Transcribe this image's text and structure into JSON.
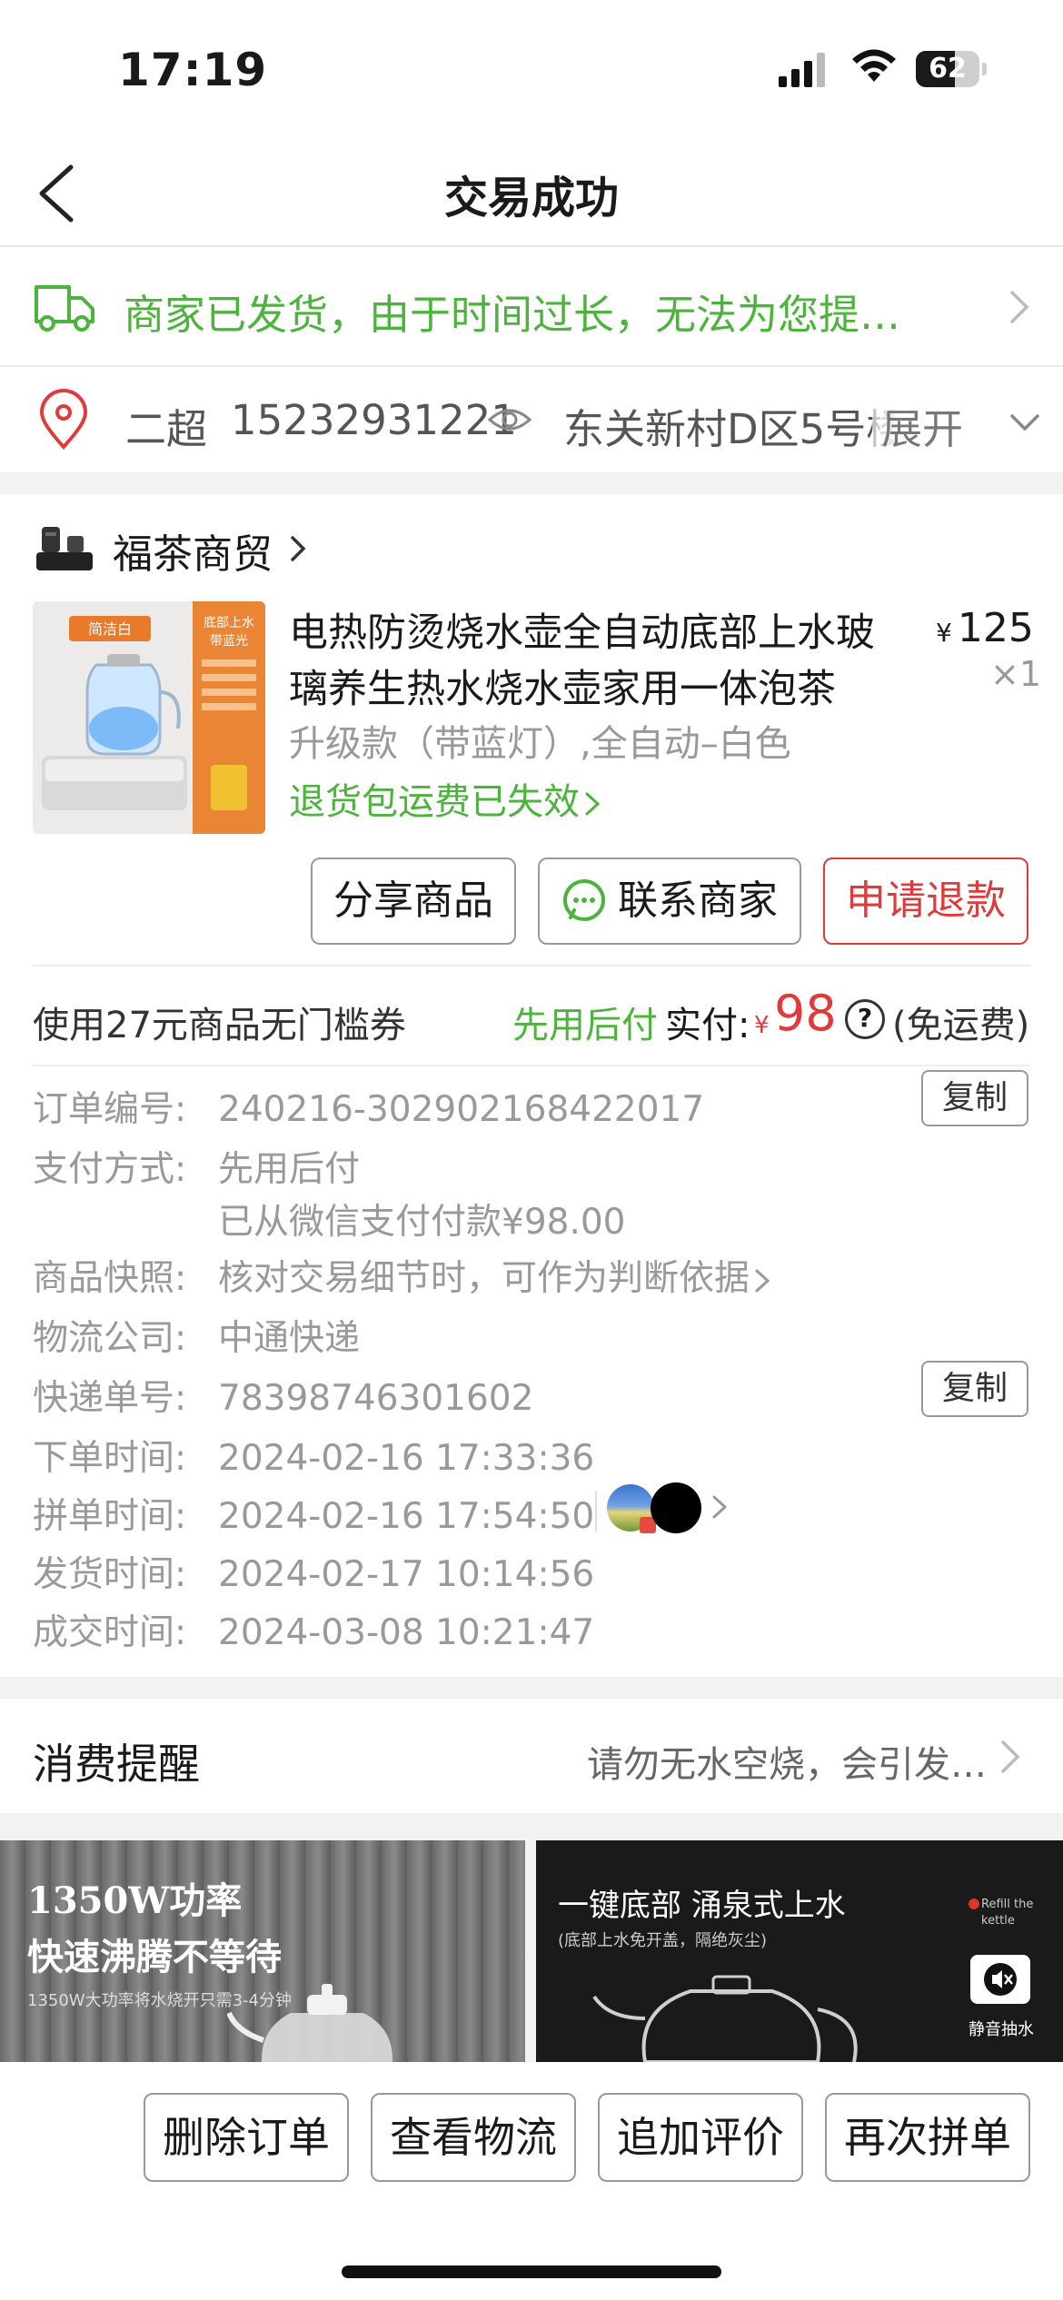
{
  "status_bar": {
    "time": "17:19",
    "battery": "62"
  },
  "nav": {
    "title": "交易成功"
  },
  "shipping": {
    "text": "商家已发货，由于时间过长，无法为您提…"
  },
  "address": {
    "name": "二超",
    "phone": "15232931221",
    "detail": "东关新村D区5号楼",
    "expand": "展开"
  },
  "shop": {
    "name": "福茶商贸"
  },
  "product": {
    "title": "电热防烫烧水壶全自动底部上水玻璃养生热水烧水壶家用一体泡茶",
    "currency": "¥",
    "price": "125",
    "qty": "×1",
    "spec": "升级款（带蓝灯）,全自动–白色",
    "return_note": "退货包运费已失效",
    "image_tag": "简洁白",
    "image_side": "底部上水带蓝光"
  },
  "actions": {
    "share": "分享商品",
    "contact": "联系商家",
    "refund": "申请退款"
  },
  "payment": {
    "coupon": "使用27元商品无门槛券",
    "pay_later": "先用后付",
    "paid_label": "实付:",
    "currency": "¥",
    "amount": "98",
    "help": "?",
    "free_shipping": "(免运费)"
  },
  "details": {
    "order_no_label": "订单编号:",
    "order_no": "240216-302902168422017",
    "copy": "复制",
    "pay_method_label": "支付方式:",
    "pay_method": "先用后付",
    "pay_method_note": "已从微信支付付款¥98.00",
    "snapshot_label": "商品快照:",
    "snapshot": "核对交易细节时，可作为判断依据",
    "courier_label": "物流公司:",
    "courier": "中通快递",
    "tracking_label": "快递单号:",
    "tracking": "78398746301602",
    "order_time_label": "下单时间:",
    "order_time": "2024-02-16 17:33:36",
    "group_time_label": "拼单时间:",
    "group_time": "2024-02-16 17:54:50",
    "ship_time_label": "发货时间:",
    "ship_time": "2024-02-17 10:14:56",
    "deal_time_label": "成交时间:",
    "deal_time": "2024-03-08 10:21:47"
  },
  "tips": {
    "title": "消费提醒",
    "text": "请勿无水空烧，会引发…"
  },
  "banners": {
    "left_line1": "1350W功率",
    "left_line2": "快速沸腾不等待",
    "left_sub": "1350W大功率将水烧开只需3-4分钟",
    "right_line1": "一键底部 涌泉式上水",
    "right_sub": "(底部上水免开盖，隔绝灰尘)",
    "right_refill": "Refill the kettle",
    "right_mute": "静音抽水"
  },
  "bottom": {
    "delete": "删除订单",
    "logistics": "查看物流",
    "review": "追加评价",
    "regroup": "再次拼单"
  },
  "colors": {
    "green": "#4cb33c",
    "red": "#e03a3a",
    "gray_text": "#999999"
  }
}
